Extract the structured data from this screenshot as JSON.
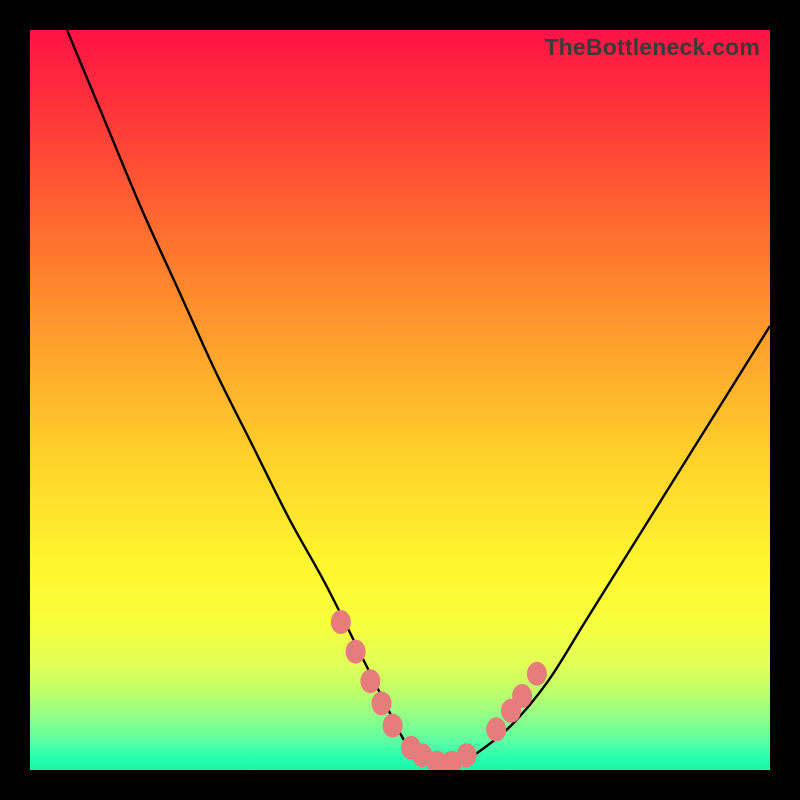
{
  "watermark": "TheBottleneck.com",
  "chart_data": {
    "type": "line",
    "title": "",
    "xlabel": "",
    "ylabel": "",
    "xlim": [
      0,
      100
    ],
    "ylim": [
      0,
      100
    ],
    "grid": false,
    "series": [
      {
        "name": "curve",
        "x": [
          5,
          10,
          15,
          20,
          25,
          30,
          35,
          40,
          45,
          48,
          50,
          52,
          55,
          58,
          60,
          65,
          70,
          75,
          80,
          85,
          90,
          95,
          100
        ],
        "y": [
          100,
          88,
          76,
          65,
          54,
          44,
          34,
          25,
          15,
          9,
          5,
          2,
          1,
          1,
          2,
          6,
          12,
          20,
          28,
          36,
          44,
          52,
          60
        ]
      }
    ],
    "markers": {
      "name": "dots",
      "x": [
        42,
        44,
        46,
        47.5,
        49,
        51.5,
        53,
        55,
        57,
        59,
        63,
        65,
        66.5,
        68.5
      ],
      "y": [
        20,
        16,
        12,
        9,
        6,
        3,
        2,
        1,
        1,
        2,
        5.5,
        8,
        10,
        13
      ]
    },
    "colors": {
      "curve": "#000000",
      "markers": "#e77c7c"
    }
  }
}
